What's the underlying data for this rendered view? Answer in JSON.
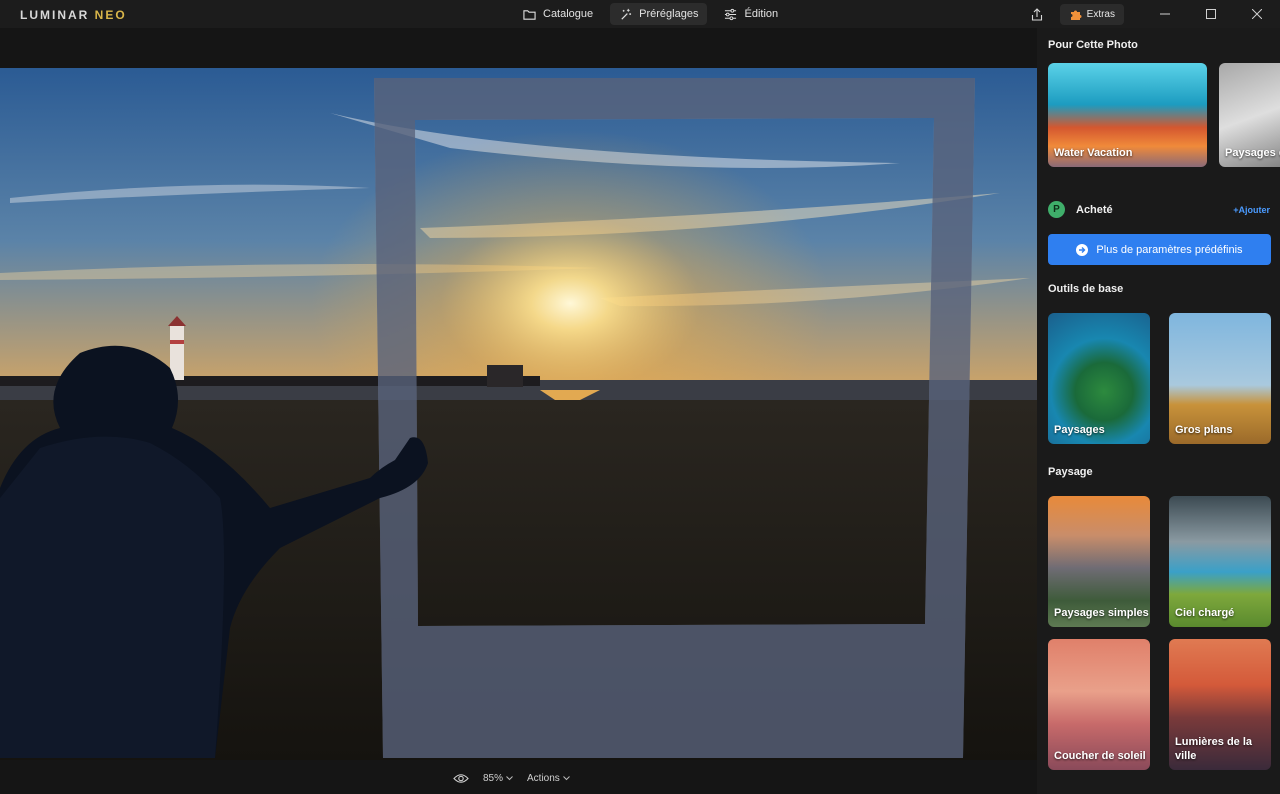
{
  "app": {
    "logo_main": "LUMINAR ",
    "logo_accent": "NEO"
  },
  "nav": [
    {
      "label": "Catalogue",
      "icon": "folder-icon"
    },
    {
      "label": "Préréglages",
      "icon": "magic-wand-icon",
      "active": true
    },
    {
      "label": "Édition",
      "icon": "sliders-icon"
    }
  ],
  "titlebar": {
    "share_icon": "share-icon",
    "extras_label": "Extras",
    "extras_icon": "puzzle-icon",
    "window_controls": [
      "minimize",
      "maximize",
      "close"
    ]
  },
  "bottom": {
    "eye_icon": "eye-icon",
    "zoom": "85%",
    "actions_label": "Actions"
  },
  "panel": {
    "for_photo_title": "Pour Cette Photo",
    "for_photo_cards": [
      {
        "label": "Water Vacation"
      },
      {
        "label": "Paysages d"
      }
    ],
    "purchased_label": "Acheté",
    "add_link": "+Ajouter",
    "more_presets": "Plus de paramètres prédéfinis",
    "basic_tools_title": "Outils de base",
    "basic_tools_cards": [
      {
        "label": "Paysages"
      },
      {
        "label": "Gros plans"
      }
    ],
    "landscape_title": "Paysage",
    "landscape_cards": [
      {
        "label": "Paysages simples"
      },
      {
        "label": "Ciel chargé"
      },
      {
        "label": "Coucher de soleil"
      },
      {
        "label": "Lumières de la ville"
      }
    ]
  },
  "colors": {
    "accent": "#2f7ff0",
    "purchased": "#3fae6a",
    "link": "#4b9bff"
  }
}
